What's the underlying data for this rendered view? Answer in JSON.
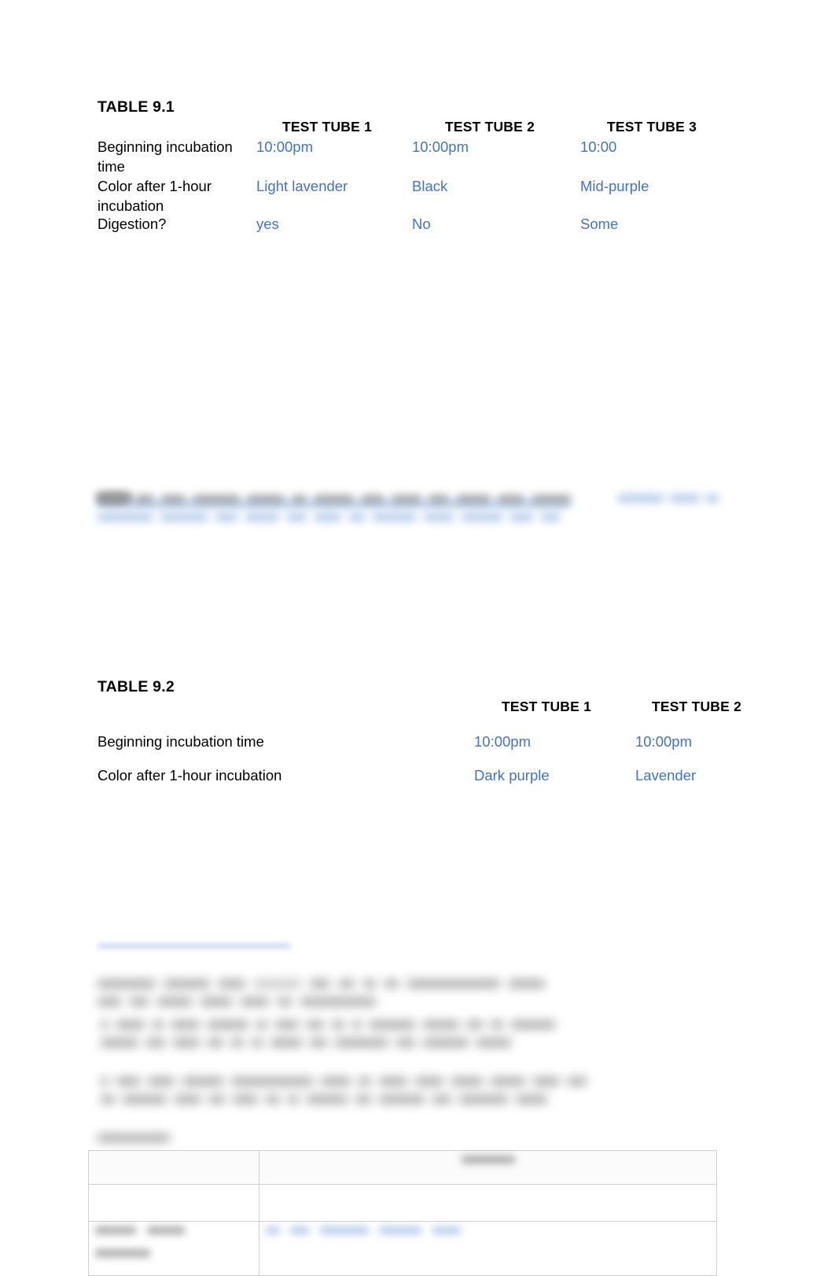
{
  "document": {
    "kind": "lab-worksheet",
    "accent_blue": "#4472c4",
    "text_black": "#000000",
    "background": "#ffffff"
  },
  "table_9_1": {
    "caption": "TABLE 9.1",
    "column_headers": [
      "TEST TUBE 1",
      "TEST TUBE 2",
      "TEST TUBE 3"
    ],
    "row_labels": [
      "Beginning incubation time",
      "Color after 1-hour incubation",
      "Digestion?"
    ],
    "rows": [
      {
        "label": "Beginning incubation time",
        "values": [
          "10:00pm",
          "10:00pm",
          "10:00"
        ]
      },
      {
        "label": "Color after 1-hour incubation",
        "values": [
          "Light lavender",
          "Black",
          "Mid-purple"
        ]
      },
      {
        "label": "Digestion?",
        "values": [
          "yes",
          "No",
          "Some"
        ]
      }
    ]
  },
  "table_9_2": {
    "caption": "TABLE 9.2",
    "column_headers": [
      "TEST TUBE 1",
      "TEST TUBE 2"
    ],
    "rows": [
      {
        "label": "Beginning incubation time",
        "values": [
          "10:00pm",
          "10:00pm"
        ]
      },
      {
        "label": "Color after 1-hour incubation",
        "values": [
          "Dark purple",
          "Lavender"
        ]
      }
    ]
  },
  "redacted": {
    "note": "blurred-illegible",
    "question_block_1": {
      "lines": 2,
      "has_blue_answer": true
    },
    "instruction_block": {
      "lines": 6
    },
    "bottom_table": {
      "has_blue_answer": true
    }
  }
}
